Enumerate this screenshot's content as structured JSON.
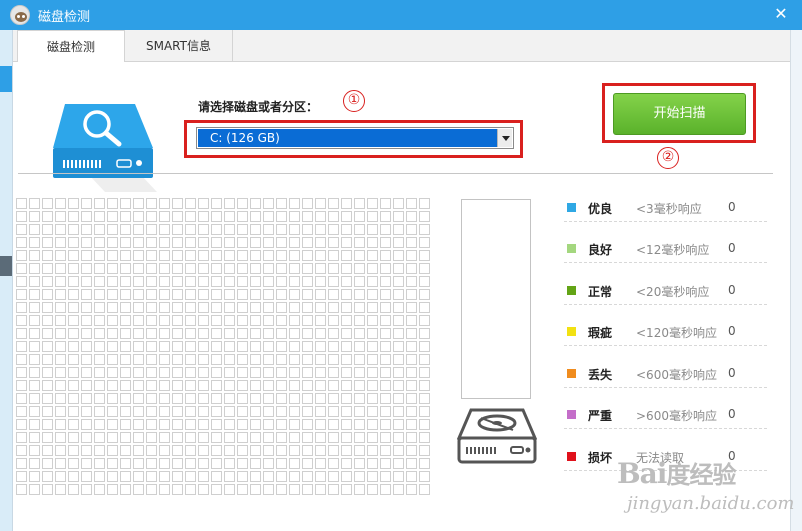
{
  "window": {
    "title": "磁盘检测",
    "close_glyph": "✕"
  },
  "tabs": [
    {
      "label": "磁盘检测",
      "active": true
    },
    {
      "label": "SMART信息",
      "active": false
    }
  ],
  "selector": {
    "label": "请选择磁盘或者分区：",
    "selected_value": "C:  (126 GB)"
  },
  "scan_button": {
    "label": "开始扫描"
  },
  "annotations": {
    "step1": "①",
    "step2": "②"
  },
  "legend": [
    {
      "name": "优良",
      "desc": "<3毫秒响应",
      "count": "0",
      "color": "#2fa8e4"
    },
    {
      "name": "良好",
      "desc": "<12毫秒响应",
      "count": "0",
      "color": "#a4d77f"
    },
    {
      "name": "正常",
      "desc": "<20毫秒响应",
      "count": "0",
      "color": "#63a416"
    },
    {
      "name": "瑕疵",
      "desc": "<120毫秒响应",
      "count": "0",
      "color": "#f2e112"
    },
    {
      "name": "丢失",
      "desc": "<600毫秒响应",
      "count": "0",
      "color": "#f08c1e"
    },
    {
      "name": "严重",
      "desc": ">600毫秒响应",
      "count": "0",
      "color": "#c46ec9"
    },
    {
      "name": "损坏",
      "desc": "无法读取",
      "count": "0",
      "color": "#e0111b"
    }
  ],
  "watermark": {
    "logo_latin_1": "Bai",
    "logo_cn": "度",
    "logo_latin_2": "经验",
    "url": "jingyan.baidu.com"
  }
}
